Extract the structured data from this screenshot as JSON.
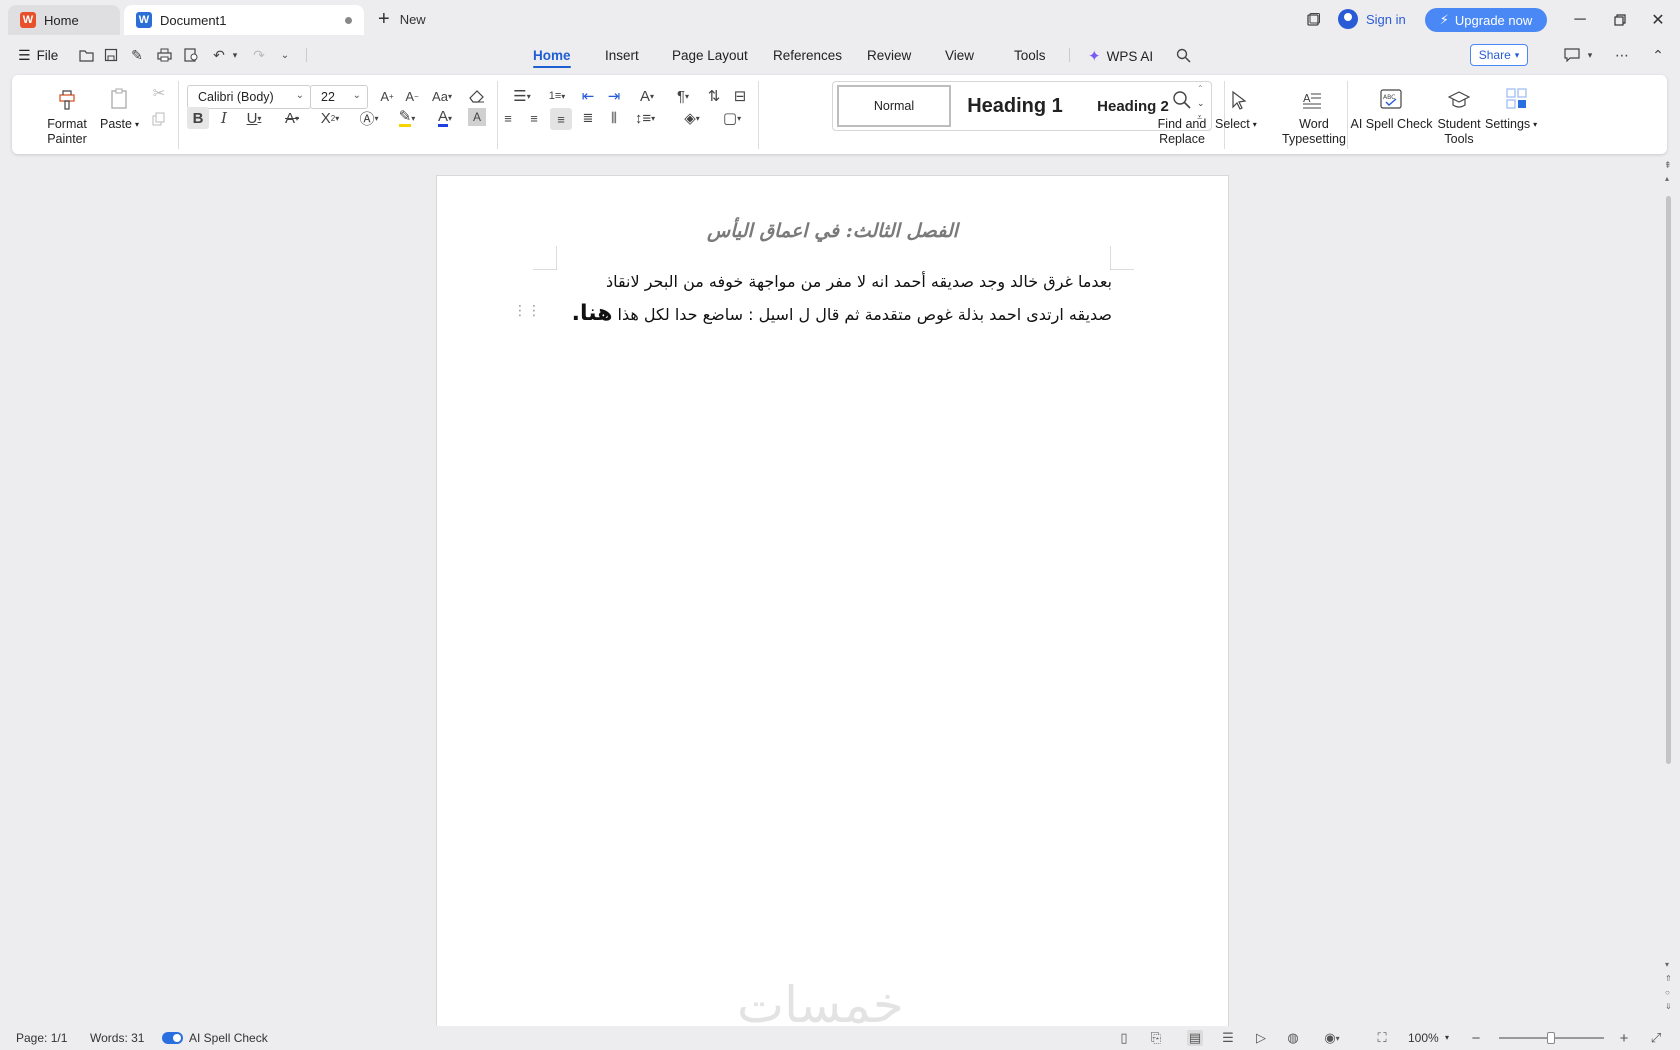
{
  "titlebar": {
    "home_tab": "Home",
    "doc_tab": "Document1",
    "new_tab": "New",
    "signin": "Sign in",
    "upgrade": "Upgrade now"
  },
  "menu": {
    "file": "File",
    "tabs": [
      "Home",
      "Insert",
      "Page Layout",
      "References",
      "Review",
      "View",
      "Tools"
    ],
    "wps_ai": "WPS AI",
    "share": "Share"
  },
  "ribbon": {
    "format_painter": "Format\nPainter",
    "paste": "Paste",
    "font": "Calibri (Body)",
    "font_size": "22",
    "styles": {
      "normal": "Normal",
      "heading1": "Heading 1",
      "heading2": "Heading 2"
    },
    "find_replace": "Find and\nReplace",
    "select": "Select",
    "word_typesetting": "Word\nTypesetting",
    "ai_spell_check": "AI Spell Check",
    "student_tools": "Student\nTools",
    "settings": "Settings"
  },
  "document": {
    "title": "الفصل الثالث: في اعماق اليأس",
    "body_line1": "بعدما غرق خالد وجد صديقه أحمد انه لا مفر من مواجهة خوفه من البحر لانقاذ",
    "body_line2": "صديقه ارتدى احمد بذلة غوص متقدمة ثم قال ل اسيل : ساضع حدا لكل هذا",
    "body_emphasis": "هنا.",
    "watermark": "خمسات"
  },
  "statusbar": {
    "page": "Page: 1/1",
    "words": "Words: 31",
    "spell_check": "AI Spell Check",
    "zoom": "100%"
  },
  "colors": {
    "accent": "#1f5fd1",
    "upgrade": "#4a88f5",
    "wps_red": "#e8502c",
    "word_blue": "#2b6fd6"
  }
}
